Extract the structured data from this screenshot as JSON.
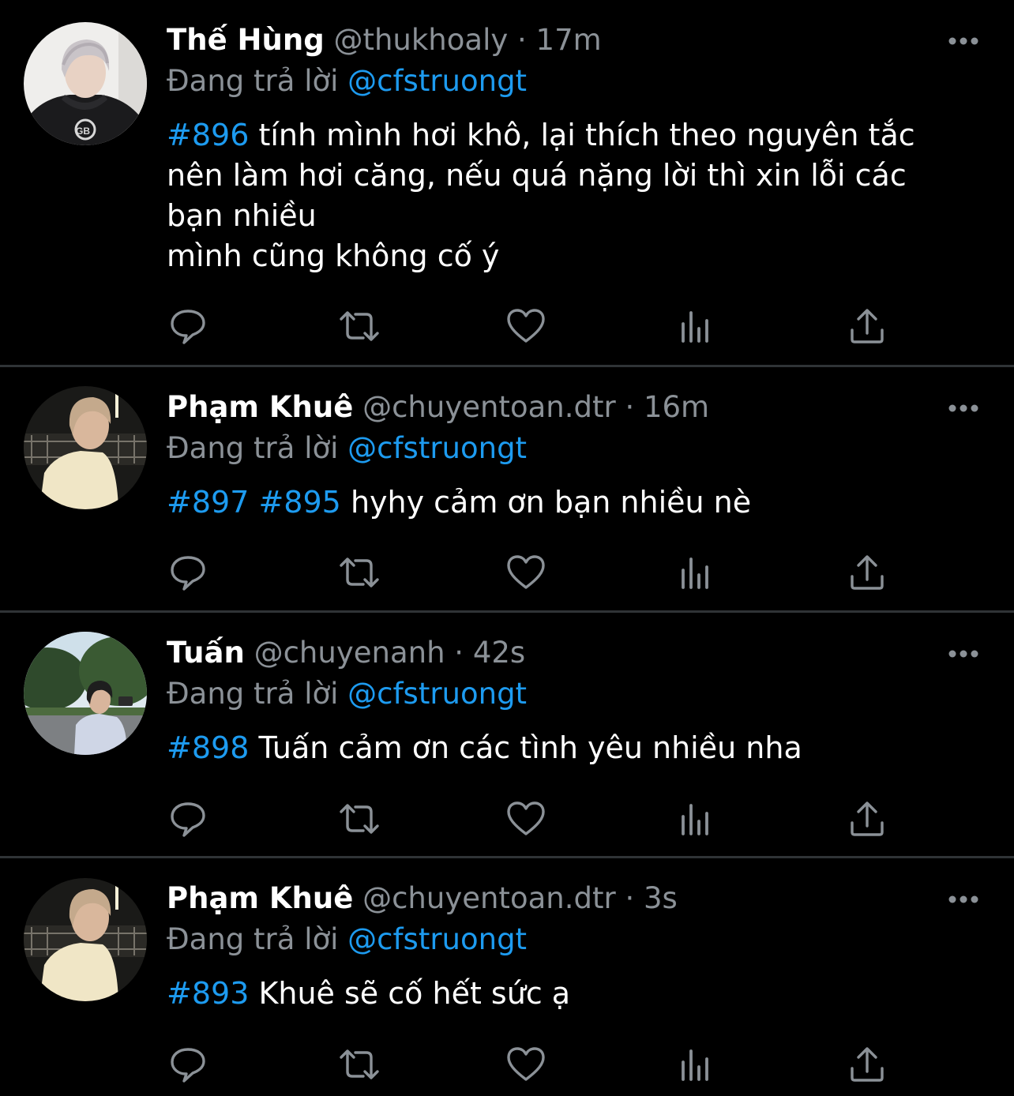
{
  "theme": {
    "background": "#000000",
    "text": "#ffffff",
    "secondary": "#8b9197",
    "accent": "#1d9bf0",
    "divider": "#2f3336"
  },
  "tweets": [
    {
      "name": "Thế Hùng",
      "handle": "@thukhoaly",
      "separator": "·",
      "time": "17m",
      "reply_prefix": "Đang trả lời",
      "reply_to": "@cfstruongt",
      "tags": [
        "#896"
      ],
      "lines": [
        "tính mình hơi khô, lại thích theo nguyên tắc",
        "nên làm hơi căng, nếu quá nặng lời thì xin lỗi các",
        "bạn nhiều",
        "mình cũng không cố ý"
      ],
      "avatar": "avatar-hoodie"
    },
    {
      "name": "Phạm Khuê",
      "handle": "@chuyentoan.dtr",
      "separator": "·",
      "time": "16m",
      "reply_prefix": "Đang trả lời",
      "reply_to": "@cfstruongt",
      "tags": [
        "#897",
        "#895"
      ],
      "lines": [
        "hyhy cảm ơn bạn nhiều nè"
      ],
      "avatar": "avatar-night"
    },
    {
      "name": "Tuấn",
      "handle": "@chuyenanh",
      "separator": "·",
      "time": "42s",
      "reply_prefix": "Đang trả lời",
      "reply_to": "@cfstruongt",
      "tags": [
        "#898"
      ],
      "lines": [
        "Tuấn cảm ơn các tình yêu nhiều nha"
      ],
      "avatar": "avatar-park"
    },
    {
      "name": "Phạm Khuê",
      "handle": "@chuyentoan.dtr",
      "separator": "·",
      "time": "3s",
      "reply_prefix": "Đang trả lời",
      "reply_to": "@cfstruongt",
      "tags": [
        "#893"
      ],
      "lines": [
        "Khuê sẽ cố hết sức ạ"
      ],
      "avatar": "avatar-night"
    }
  ],
  "action_icons": [
    "reply-icon",
    "retweet-icon",
    "like-icon",
    "analytics-icon",
    "share-icon"
  ]
}
